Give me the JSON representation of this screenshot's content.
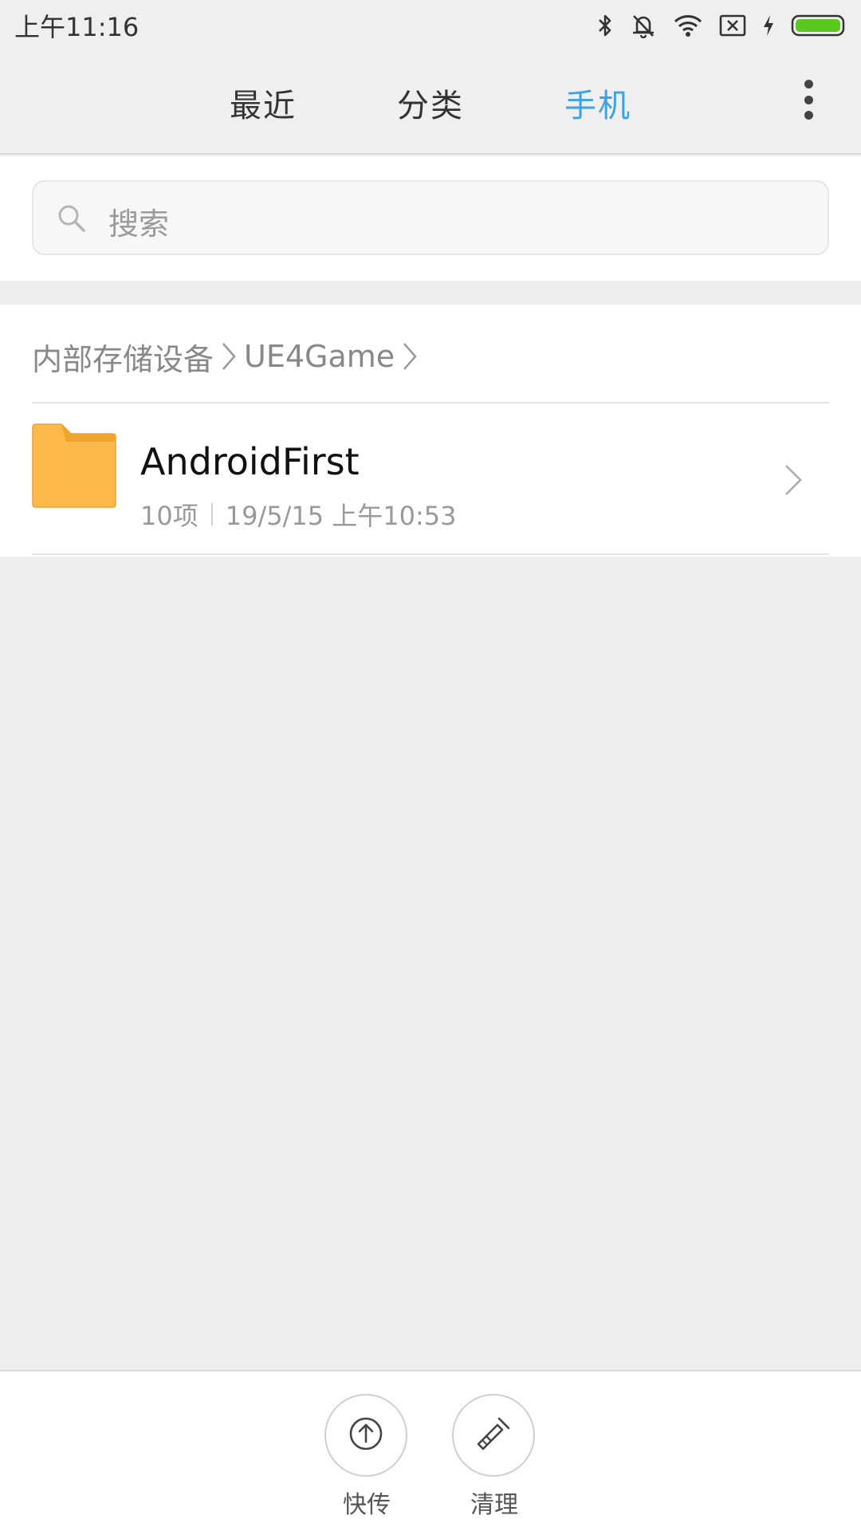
{
  "status_bar": {
    "time": "上午11:16",
    "battery_color": "#5ac81e"
  },
  "tabs": [
    {
      "label": "最近",
      "active": false
    },
    {
      "label": "分类",
      "active": false
    },
    {
      "label": "手机",
      "active": true
    }
  ],
  "accent_color": "#3aa3e8",
  "search": {
    "placeholder": "搜索"
  },
  "breadcrumb": [
    "内部存储设备",
    "UE4Game"
  ],
  "files": [
    {
      "name": "AndroidFirst",
      "item_count": "10项",
      "modified": "19/5/15 上午10:53",
      "icon": "folder-icon",
      "icon_color": "#fcb94a"
    }
  ],
  "bottom_actions": [
    {
      "label": "快传",
      "icon": "upload-circle-icon"
    },
    {
      "label": "清理",
      "icon": "broom-icon"
    }
  ]
}
